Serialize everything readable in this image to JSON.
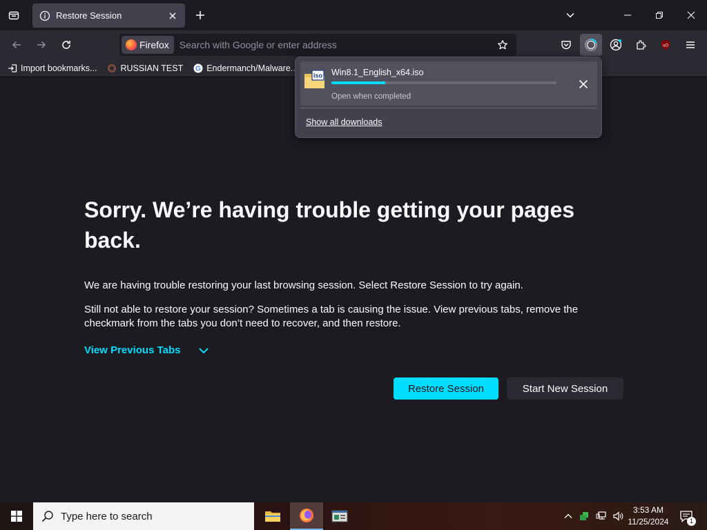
{
  "tab": {
    "title": "Restore Session"
  },
  "urlbar": {
    "identity_label": "Firefox",
    "placeholder": "Search with Google or enter address"
  },
  "bookmarks": [
    {
      "label": "Import bookmarks...",
      "icon": "import-icon"
    },
    {
      "label": "RUSSIAN TEST",
      "icon": "site-icon"
    },
    {
      "label": "Endermanch/Malware...",
      "icon": "google-icon"
    }
  ],
  "downloads": {
    "filename": "Win8.1_English_x64.iso",
    "status": "Open when completed",
    "progress": 0.24,
    "show_all": "Show all downloads",
    "file_icon_label": "iso"
  },
  "page": {
    "title": "Sorry. We’re having trouble getting your pages back.",
    "para1": "We are having trouble restoring your last browsing session. Select Restore Session to try again.",
    "para2": "Still not able to restore your session? Sometimes a tab is causing the issue. View previous tabs, remove the checkmark from the tabs you don’t need to recover, and then restore.",
    "view_previous_tabs": "View Previous Tabs",
    "restore_button": "Restore Session",
    "new_session_button": "Start New Session"
  },
  "taskbar": {
    "search_placeholder": "Type here to search",
    "time": "3:53 AM",
    "date": "11/25/2024",
    "notification_count": "1"
  },
  "colors": {
    "accent": "#00ddff",
    "toolbar": "#2b2a33",
    "background": "#1c1b22"
  }
}
